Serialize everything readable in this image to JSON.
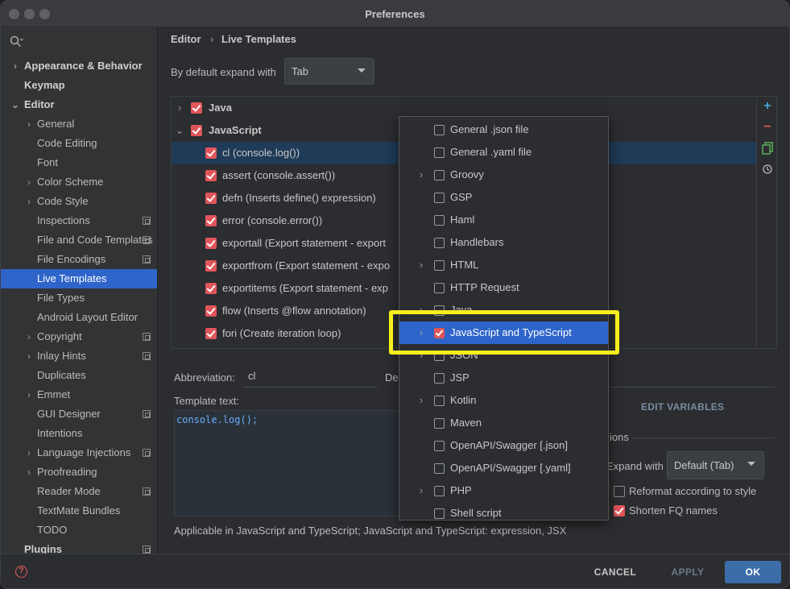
{
  "window": {
    "title": "Preferences"
  },
  "sidebar": {
    "items": [
      {
        "label": "Appearance & Behavior",
        "chevron": ">",
        "bold": true
      },
      {
        "label": "Keymap",
        "bold": true
      },
      {
        "label": "Editor",
        "chevron": "v",
        "bold": true
      },
      {
        "label": "General",
        "chevron": ">"
      },
      {
        "label": "Code Editing"
      },
      {
        "label": "Font"
      },
      {
        "label": "Color Scheme",
        "chevron": ">"
      },
      {
        "label": "Code Style",
        "chevron": ">"
      },
      {
        "label": "Inspections",
        "page_icon": true
      },
      {
        "label": "File and Code Templates",
        "page_icon": true
      },
      {
        "label": "File Encodings",
        "page_icon": true
      },
      {
        "label": "Live Templates",
        "selected": true
      },
      {
        "label": "File Types"
      },
      {
        "label": "Android Layout Editor"
      },
      {
        "label": "Copyright",
        "chevron": ">",
        "page_icon": true
      },
      {
        "label": "Inlay Hints",
        "chevron": ">",
        "page_icon": true
      },
      {
        "label": "Duplicates"
      },
      {
        "label": "Emmet",
        "chevron": ">"
      },
      {
        "label": "GUI Designer",
        "page_icon": true
      },
      {
        "label": "Intentions"
      },
      {
        "label": "Language Injections",
        "chevron": ">",
        "page_icon": true
      },
      {
        "label": "Proofreading",
        "chevron": ">"
      },
      {
        "label": "Reader Mode",
        "page_icon": true
      },
      {
        "label": "TextMate Bundles"
      },
      {
        "label": "TODO"
      },
      {
        "label": "Plugins",
        "bold": true,
        "page_icon": true
      }
    ]
  },
  "breadcrumb": {
    "parent": "Editor",
    "separator": "›",
    "current": "Live Templates"
  },
  "expand": {
    "label": "By default expand with",
    "value": "Tab"
  },
  "templates": {
    "groups": [
      {
        "label": "Java",
        "chevron": ">"
      },
      {
        "label": "JavaScript",
        "chevron": "v"
      }
    ],
    "items": [
      {
        "label": "cl (console.log())",
        "selected": true
      },
      {
        "label": "assert (console.assert())"
      },
      {
        "label": "defn (Inserts define() expression)"
      },
      {
        "label": "error (console.error())"
      },
      {
        "label": "exportall (Export statement - export"
      },
      {
        "label": "exportfrom (Export statement - expo"
      },
      {
        "label": "exportitems (Export statement - exp"
      },
      {
        "label": "flow (Inserts @flow annotation)"
      },
      {
        "label": "fori (Create iteration loop)"
      }
    ]
  },
  "toolbar": {
    "add": "+",
    "remove": "−"
  },
  "editor": {
    "abbreviation_label": "Abbreviation:",
    "abbreviation_value": "cl",
    "description_label_partial": "De",
    "template_text_label": "Template text:",
    "template_text": "console.log();",
    "edit_variables": "EDIT VARIABLES",
    "options_partial": "ions",
    "expand_with_label": "Expand with",
    "expand_with_value": "Default (Tab)",
    "reformat_label": "Reformat according to style",
    "shorten_label": "Shorten FQ names",
    "applicable_text": "Applicable in JavaScript and TypeScript; JavaScript and TypeScript: expression, JSX"
  },
  "popup": {
    "items": [
      {
        "label": "General .json file",
        "checked": false
      },
      {
        "label": "General .yaml file",
        "checked": false
      },
      {
        "label": "Groovy",
        "checked": false,
        "chevron": ">"
      },
      {
        "label": "GSP",
        "checked": false
      },
      {
        "label": "Haml",
        "checked": false
      },
      {
        "label": "Handlebars",
        "checked": false
      },
      {
        "label": "HTML",
        "checked": false,
        "chevron": ">"
      },
      {
        "label": "HTTP Request",
        "checked": false
      },
      {
        "label": "Java",
        "checked": false,
        "chevron": ">"
      },
      {
        "label": "JavaScript and TypeScript",
        "checked": true,
        "chevron": ">",
        "highlighted": true
      },
      {
        "label": "JSON",
        "checked": false,
        "chevron": ">"
      },
      {
        "label": "JSP",
        "checked": false
      },
      {
        "label": "Kotlin",
        "checked": false,
        "chevron": ">"
      },
      {
        "label": "Maven",
        "checked": false
      },
      {
        "label": "OpenAPI/Swagger [.json]",
        "checked": false
      },
      {
        "label": "OpenAPI/Swagger [.yaml]",
        "checked": false
      },
      {
        "label": "PHP",
        "checked": false,
        "chevron": ">"
      },
      {
        "label": "Shell script",
        "checked": false
      }
    ]
  },
  "buttons": {
    "help": "?",
    "cancel": "CANCEL",
    "apply": "APPLY",
    "ok": "OK"
  },
  "colors": {
    "accent": "#2f65ca",
    "checkbox": "#e0555a",
    "highlight": "#f6ef1c"
  }
}
